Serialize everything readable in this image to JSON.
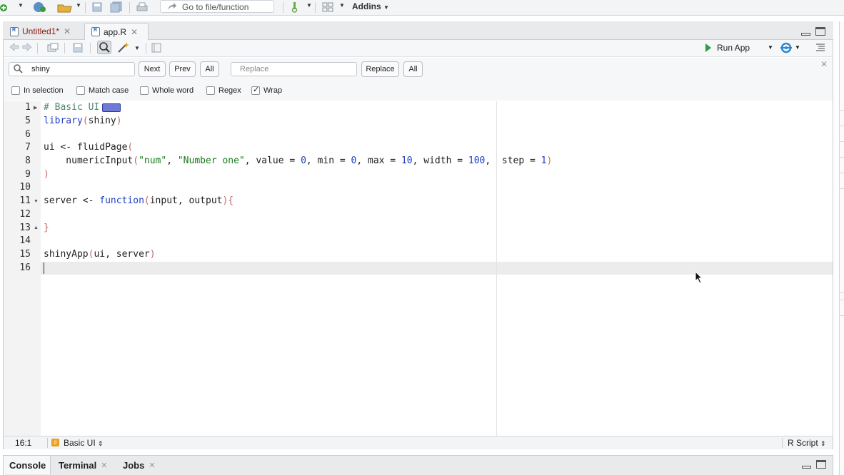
{
  "toolbar": {
    "goto_placeholder": "Go to file/function",
    "addins_label": "Addins"
  },
  "tabs": [
    {
      "label": "Untitled1*",
      "active": false
    },
    {
      "label": "app.R",
      "active": true
    }
  ],
  "editor_toolbar": {
    "run_app_label": "Run App"
  },
  "find": {
    "search_value": "shiny",
    "next_label": "Next",
    "prev_label": "Prev",
    "all_label": "All",
    "replace_placeholder": "Replace",
    "replace_label": "Replace",
    "replace_all_label": "All",
    "options": [
      {
        "label": "In selection",
        "checked": false
      },
      {
        "label": "Match case",
        "checked": false
      },
      {
        "label": "Whole word",
        "checked": false
      },
      {
        "label": "Regex",
        "checked": false
      },
      {
        "label": "Wrap",
        "checked": true
      }
    ]
  },
  "code": {
    "line_numbers": [
      "1",
      "5",
      "6",
      "7",
      "8",
      "9",
      "10",
      "11",
      "12",
      "13",
      "14",
      "15",
      "16"
    ],
    "lines": {
      "l1_comment": "# Basic UI",
      "l5_fn": "library",
      "l5_open": "(",
      "l5_arg": "shiny",
      "l5_close": ")",
      "l7_a": "ui <- fluidPage",
      "l7_open": "(",
      "l8_fn": "    numericInput",
      "l8_open": "(",
      "l8_s1": "\"num\"",
      "l8_c1": ", ",
      "l8_s2": "\"Number one\"",
      "l8_c2": ", value = ",
      "l8_n1": "0",
      "l8_c3": ", min = ",
      "l8_n2": "0",
      "l8_c4": ", max = ",
      "l8_n3": "10",
      "l8_c5": ", width = ",
      "l8_n4": "100",
      "l8_c6": ",  step = ",
      "l8_n5": "1",
      "l8_close": ")",
      "l9_close": ")",
      "l11_a": "server <- ",
      "l11_kw": "function",
      "l11_open": "(",
      "l11_args": "input, output",
      "l11_close": "){",
      "l13_close": "}",
      "l15_fn": "shinyApp",
      "l15_open": "(",
      "l15_args": "ui, server",
      "l15_close": ")"
    }
  },
  "status": {
    "position": "16:1",
    "section": "Basic UI",
    "file_type": "R Script"
  },
  "console_tabs": [
    {
      "label": "Console"
    },
    {
      "label": "Terminal"
    },
    {
      "label": "Jobs"
    }
  ],
  "colors": {
    "run_green": "#2c9e3f",
    "keyword_blue": "#1f3ec2",
    "string_green": "#1a7a1a",
    "unsaved_red": "#8b1a10"
  }
}
